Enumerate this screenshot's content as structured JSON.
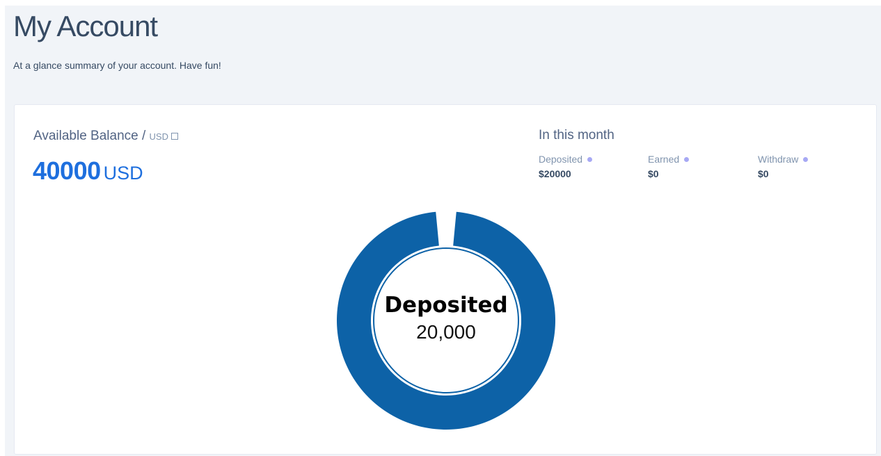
{
  "header": {
    "title": "My Account",
    "subtitle": "At a glance summary of your account. Have fun!"
  },
  "balance": {
    "label": "Available Balance / ",
    "unit_small": "USD",
    "amount": "40000",
    "currency": "USD"
  },
  "month": {
    "title": "In this month",
    "stats": [
      {
        "label": "Deposited",
        "value": "$20000"
      },
      {
        "label": "Earned",
        "value": "$0"
      },
      {
        "label": "Withdraw",
        "value": "$0"
      }
    ]
  },
  "colors": {
    "accent": "#1e6fde",
    "donut": "#0d62a7",
    "dot": "#a7a9f4"
  },
  "chart_data": {
    "type": "pie",
    "categories": [
      "Deposited",
      "Earned",
      "Withdraw"
    ],
    "values": [
      20000,
      0,
      0
    ],
    "center_label": "Deposited",
    "center_value": "20,000"
  }
}
